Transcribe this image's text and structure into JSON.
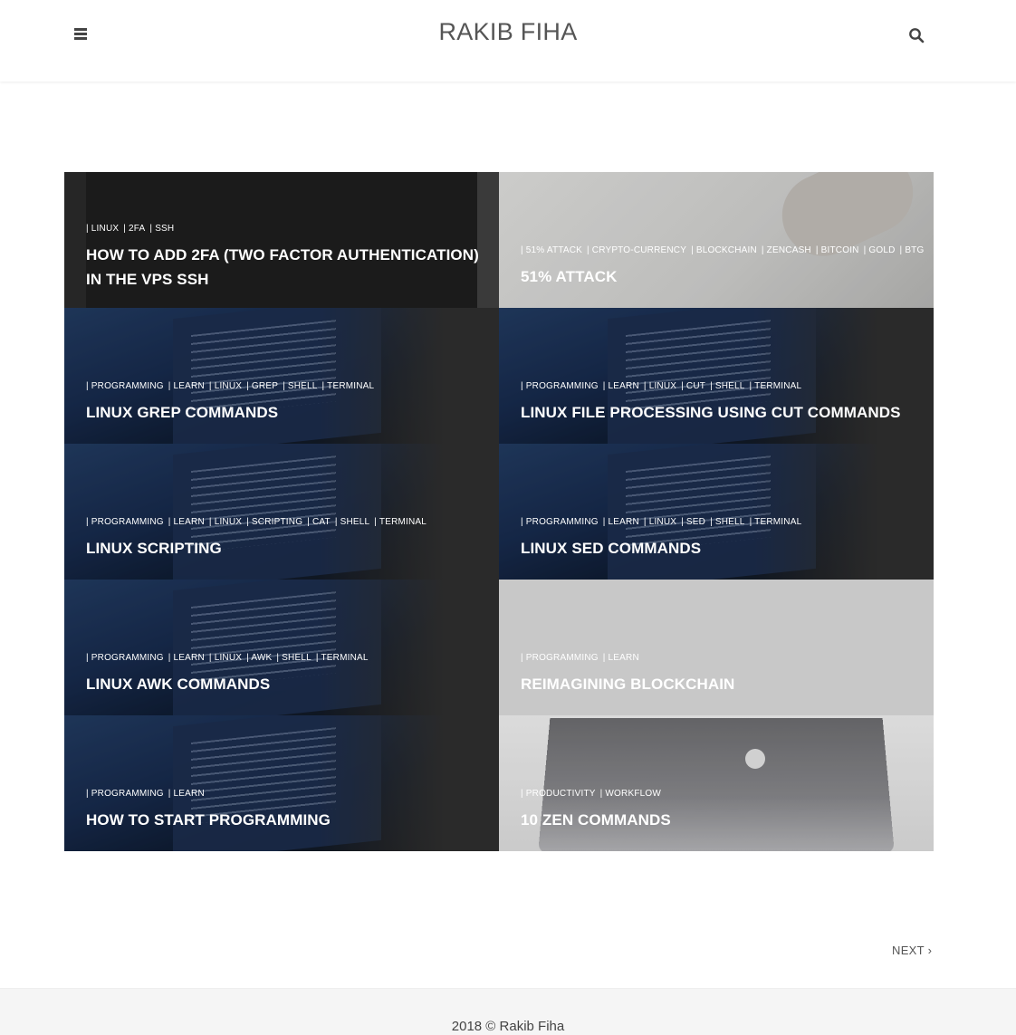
{
  "header": {
    "brand": "RAKIB FIHA",
    "menu_icon": "hamburger-menu-icon",
    "search_icon": "search-icon"
  },
  "posts": [
    {
      "tags": [
        "LINUX",
        "2FA",
        "SSH"
      ],
      "title": "HOW TO ADD 2FA (TWO FACTOR AUTHENTICATION) IN THE VPS SSH"
    },
    {
      "tags": [
        "51% ATTACK",
        "CRYPTO-CURRENCY",
        "BLOCKCHAIN",
        "ZENCASH",
        "BITCOIN",
        "GOLD",
        "BTG"
      ],
      "title": "51% ATTACK"
    },
    {
      "tags": [
        "PROGRAMMING",
        "LEARN",
        "LINUX",
        "GREP",
        "SHELL",
        "TERMINAL"
      ],
      "title": "LINUX GREP COMMANDS"
    },
    {
      "tags": [
        "PROGRAMMING",
        "LEARN",
        "LINUX",
        "CUT",
        "SHELL",
        "TERMINAL"
      ],
      "title": "LINUX FILE PROCESSING USING CUT COMMANDS"
    },
    {
      "tags": [
        "PROGRAMMING",
        "LEARN",
        "LINUX",
        "SCRIPTING",
        "CAT",
        "SHELL",
        "TERMINAL"
      ],
      "title": "LINUX SCRIPTING"
    },
    {
      "tags": [
        "PROGRAMMING",
        "LEARN",
        "LINUX",
        "SED",
        "SHELL",
        "TERMINAL"
      ],
      "title": "LINUX SED COMMANDS"
    },
    {
      "tags": [
        "PROGRAMMING",
        "LEARN",
        "LINUX",
        "AWK",
        "SHELL",
        "TERMINAL"
      ],
      "title": "LINUX AWK COMMANDS"
    },
    {
      "tags": [
        "PROGRAMMING",
        "LEARN"
      ],
      "title": "REIMAGINING BLOCKCHAIN"
    },
    {
      "tags": [
        "PROGRAMMING",
        "LEARN"
      ],
      "title": "HOW TO START PROGRAMMING"
    },
    {
      "tags": [
        "PRODUCTIVITY",
        "WORKFLOW"
      ],
      "title": "10 ZEN COMMANDS"
    }
  ],
  "pagination": {
    "next_label": "NEXT",
    "next_icon": "chevron-right-icon"
  },
  "footer": {
    "copyright": "2018 © Rakib Fiha"
  }
}
